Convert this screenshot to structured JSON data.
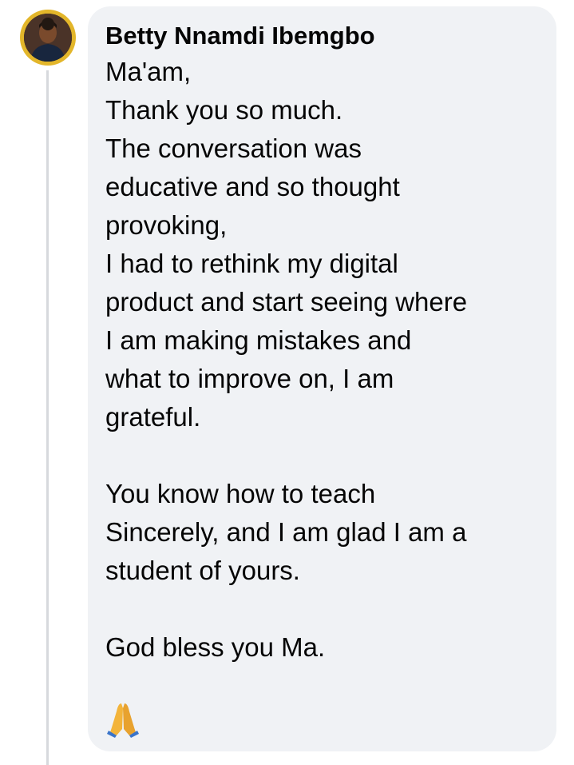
{
  "comment": {
    "author": "Betty Nnamdi Ibemgbo",
    "paragraphs": [
      [
        "Ma'am,",
        "Thank you so much.",
        "The conversation was",
        "educative and so thought",
        "provoking,",
        "I had to rethink my digital",
        "product and start seeing where",
        "I am making mistakes and",
        "what to improve on, I am",
        "grateful."
      ],
      [
        "You know how to teach",
        "Sincerely, and I am glad I am a",
        "student of yours."
      ],
      [
        "God bless you Ma."
      ]
    ],
    "reaction_icon": "praying-hands-icon",
    "avatar_ring_color": "#e3b62a",
    "bubble_color": "#f0f2f5"
  }
}
